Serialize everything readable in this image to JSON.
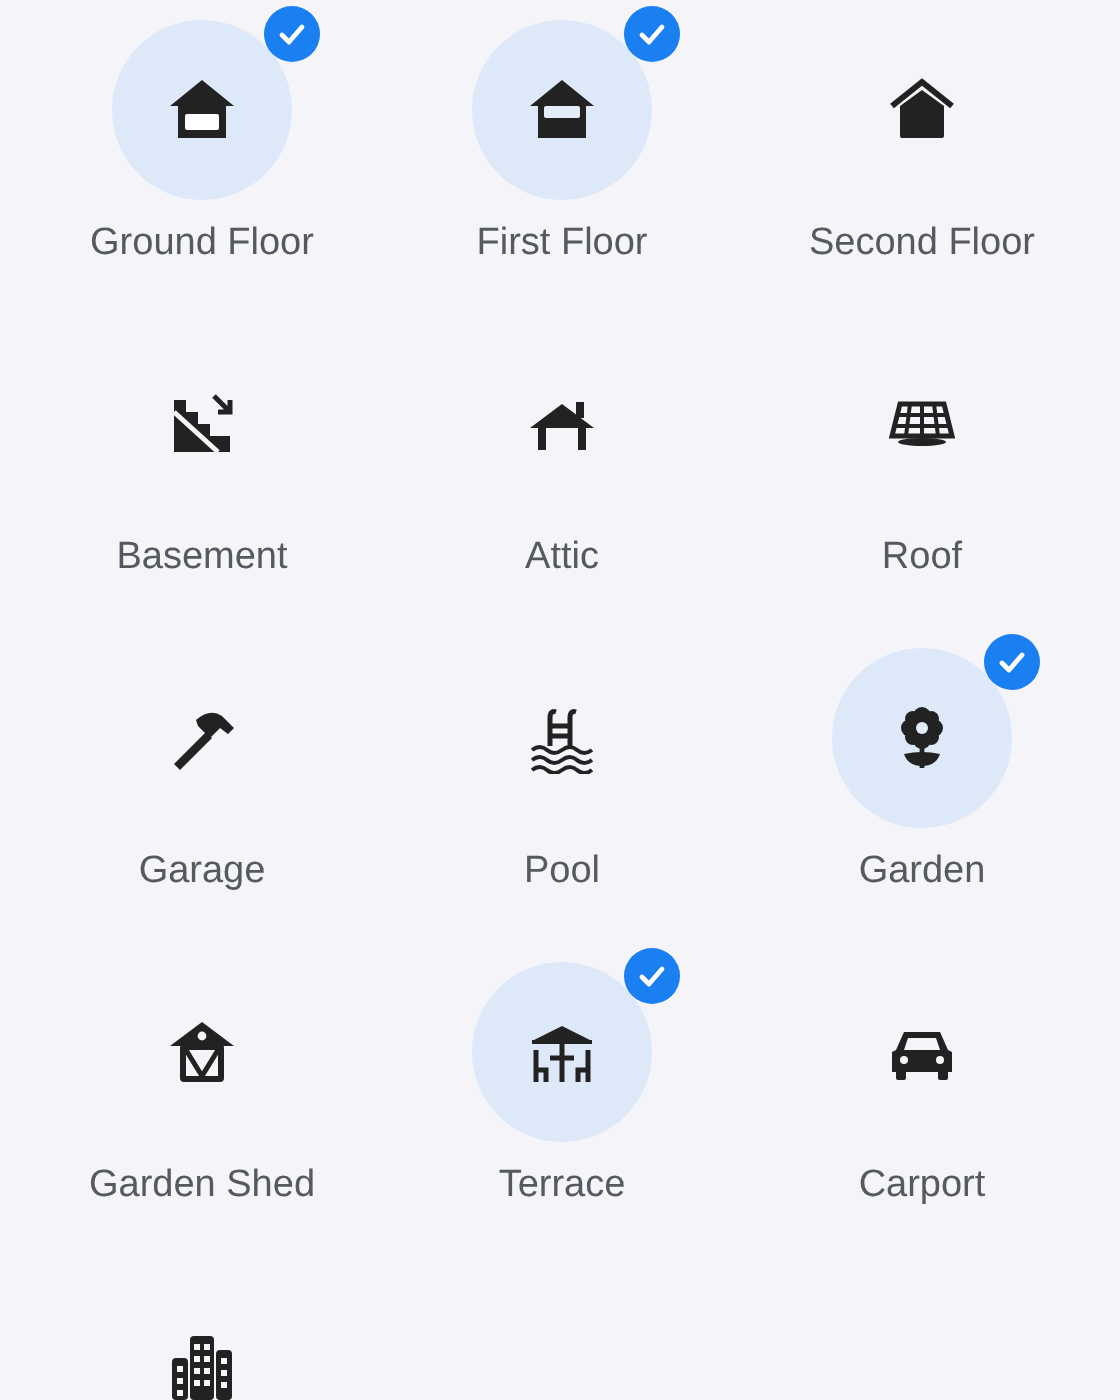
{
  "areas": [
    {
      "kind": "ground-floor",
      "label": "Ground Floor",
      "selected": true
    },
    {
      "kind": "first-floor",
      "label": "First Floor",
      "selected": true
    },
    {
      "kind": "second-floor",
      "label": "Second Floor",
      "selected": false
    },
    {
      "kind": "basement",
      "label": "Basement",
      "selected": false
    },
    {
      "kind": "attic",
      "label": "Attic",
      "selected": false
    },
    {
      "kind": "roof",
      "label": "Roof",
      "selected": false
    },
    {
      "kind": "garage",
      "label": "Garage",
      "selected": false
    },
    {
      "kind": "pool",
      "label": "Pool",
      "selected": false
    },
    {
      "kind": "garden",
      "label": "Garden",
      "selected": true
    },
    {
      "kind": "shed",
      "label": "Garden Shed",
      "selected": false
    },
    {
      "kind": "terrace",
      "label": "Terrace",
      "selected": true
    },
    {
      "kind": "carport",
      "label": "Carport",
      "selected": false
    },
    {
      "kind": "building",
      "selected": false
    }
  ]
}
